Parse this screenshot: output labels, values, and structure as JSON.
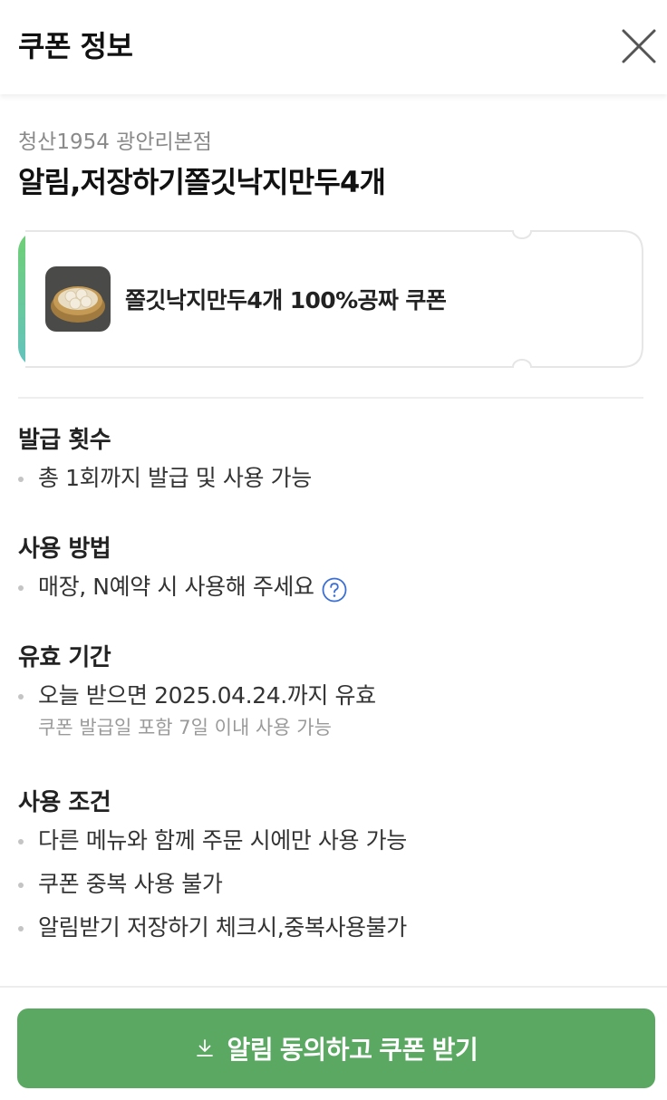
{
  "header": {
    "title": "쿠폰 정보",
    "close_icon": "close-icon"
  },
  "coupon": {
    "store_name": "청산1954 광안리본점",
    "title": "알림,저장하기쫄깃낙지만두4개",
    "ticket_label": "쫄깃낙지만두4개 100%공짜 쿠폰",
    "accent_gradient": [
      "#6fcf73",
      "#63c3c0"
    ]
  },
  "sections": {
    "issue_count": {
      "title": "발급 횟수",
      "items": [
        "총 1회까지 발급 및 사용 가능"
      ]
    },
    "usage_method": {
      "title": "사용 방법",
      "items": [
        "매장, N예약 시 사용해 주세요"
      ],
      "help_icon": "question-circle-icon"
    },
    "validity": {
      "title": "유효 기간",
      "items": [
        "오늘 받으면 2025.04.24.까지 유효"
      ],
      "note": "쿠폰 발급일 포함 7일 이내 사용 가능"
    },
    "conditions": {
      "title": "사용 조건",
      "items": [
        "다른 메뉴와 함께 주문 시에만 사용 가능",
        "쿠폰 중복 사용 불가",
        "알림받기 저장하기 체크시,중복사용불가"
      ]
    }
  },
  "footer": {
    "cta_label": "알림 동의하고 쿠폰 받기",
    "cta_icon": "download-icon",
    "cta_color": "#5ba862"
  }
}
